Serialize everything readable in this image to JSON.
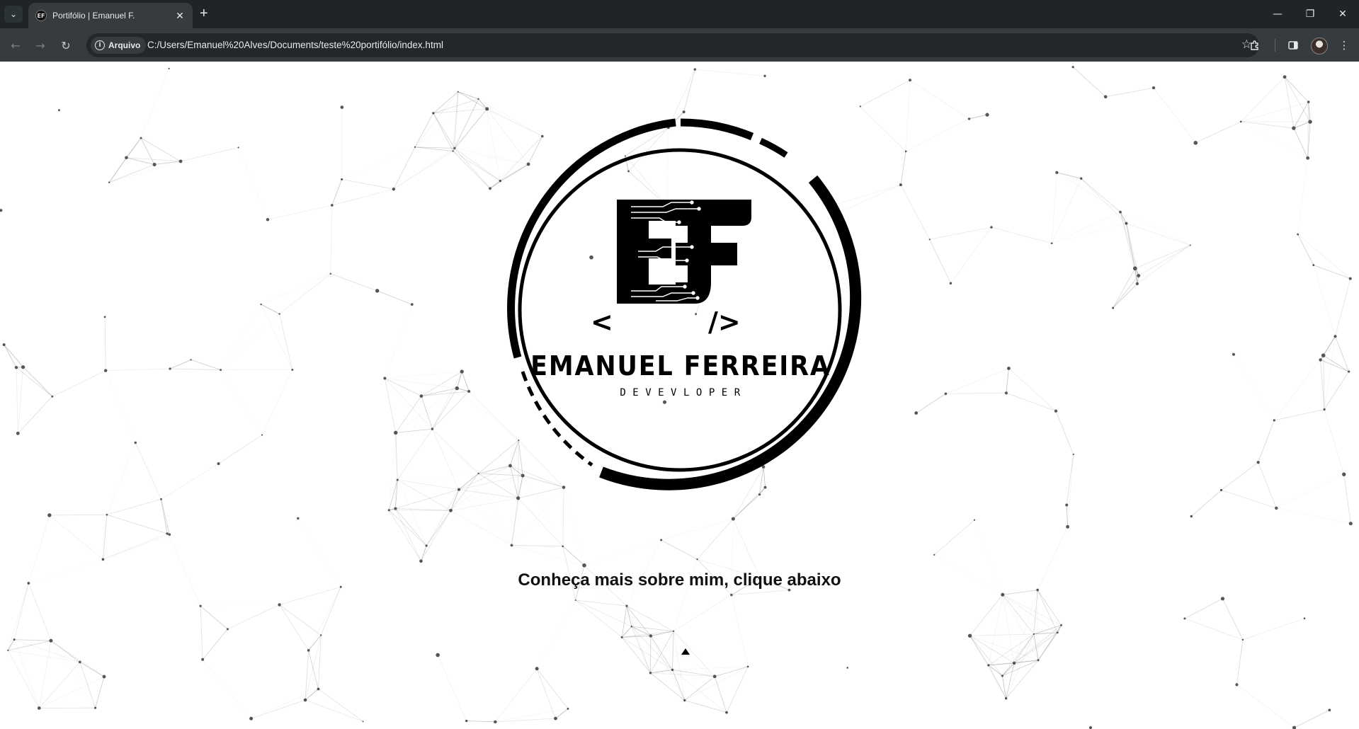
{
  "browser": {
    "tab_title": "Portifólio | Emanuel F.",
    "favicon_letter": "EF",
    "new_tab_symbol": "+",
    "close_symbol": "✕",
    "window": {
      "minimize": "—",
      "restore": "❐",
      "close": "✕"
    },
    "nav": {
      "back": "←",
      "forward": "→",
      "reload": "↻"
    },
    "site_info_label": "Arquivo",
    "url": "C:/Users/Emanuel%20Alves/Documents/teste%20portifólio/index.html",
    "bookmark_symbol": "☆"
  },
  "page": {
    "logo": {
      "name": "EMANUEL FERREIRA",
      "role": "DEVEVLOPER",
      "tag_open": "<",
      "tag_close": "/>",
      "monogram": "EF"
    },
    "cta_text": "Conheça mais sobre mim, clique abaixo",
    "colors": {
      "background": "#ffffff",
      "logo": "#000000",
      "network_lines": "#9a9a9a"
    }
  }
}
